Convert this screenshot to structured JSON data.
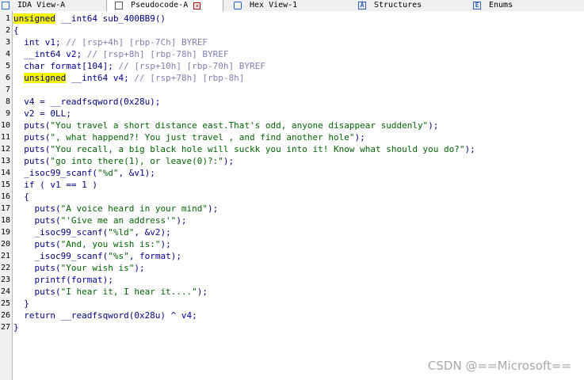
{
  "tabs": [
    {
      "label": "IDA View-A",
      "icon": "ida-view-icon",
      "closable": false,
      "active": false
    },
    {
      "label": "Pseudocode-A",
      "icon": "pseudocode-icon",
      "closable": true,
      "active": true
    },
    {
      "label": "Hex View-1",
      "icon": "hex-view-icon",
      "closable": false,
      "active": false
    },
    {
      "label": "Structures",
      "icon": "structures-icon",
      "closable": false,
      "active": false
    },
    {
      "label": "Enums",
      "icon": "enums-icon",
      "closable": false,
      "active": false
    }
  ],
  "close_glyph": "×",
  "code_lines": [
    {
      "n": "1",
      "tokens": [
        {
          "t": "unsigned",
          "c": "hl"
        },
        {
          "t": " __int64 sub_400BB9()",
          "c": "plain"
        }
      ]
    },
    {
      "n": "2",
      "tokens": [
        {
          "t": "{",
          "c": "plain"
        }
      ]
    },
    {
      "n": "3",
      "tokens": [
        {
          "t": "  int ",
          "c": "kw"
        },
        {
          "t": "v1",
          "c": "var"
        },
        {
          "t": "; ",
          "c": "plain"
        },
        {
          "t": "// [rsp+4h] [rbp-7Ch] BYREF",
          "c": "cmt"
        }
      ]
    },
    {
      "n": "4",
      "tokens": [
        {
          "t": "  __int64 ",
          "c": "kw"
        },
        {
          "t": "v2",
          "c": "var"
        },
        {
          "t": "; ",
          "c": "plain"
        },
        {
          "t": "// [rsp+8h] [rbp-78h] BYREF",
          "c": "cmt"
        }
      ]
    },
    {
      "n": "5",
      "tokens": [
        {
          "t": "  char ",
          "c": "kw"
        },
        {
          "t": "format",
          "c": "var"
        },
        {
          "t": "[104]; ",
          "c": "plain"
        },
        {
          "t": "// [rsp+10h] [rbp-70h] BYREF",
          "c": "cmt"
        }
      ]
    },
    {
      "n": "6",
      "tokens": [
        {
          "t": "  ",
          "c": "plain"
        },
        {
          "t": "unsigned",
          "c": "hl"
        },
        {
          "t": " __int64 ",
          "c": "kw"
        },
        {
          "t": "v4",
          "c": "var"
        },
        {
          "t": "; ",
          "c": "plain"
        },
        {
          "t": "// [rsp+78h] [rbp-8h]",
          "c": "cmt"
        }
      ]
    },
    {
      "n": "7",
      "tokens": []
    },
    {
      "n": "8",
      "tokens": [
        {
          "t": "  v4 = __readfsqword(0x28u);",
          "c": "plain"
        }
      ]
    },
    {
      "n": "9",
      "tokens": [
        {
          "t": "  v2 = 0LL;",
          "c": "plain"
        }
      ]
    },
    {
      "n": "10",
      "tokens": [
        {
          "t": "  puts(",
          "c": "plain"
        },
        {
          "t": "\"You travel a short distance east.That's odd, anyone disappear suddenly\"",
          "c": "str"
        },
        {
          "t": ");",
          "c": "plain"
        }
      ]
    },
    {
      "n": "11",
      "tokens": [
        {
          "t": "  puts(",
          "c": "plain"
        },
        {
          "t": "\", what happend?! You just travel , and find another hole\"",
          "c": "str"
        },
        {
          "t": ");",
          "c": "plain"
        }
      ]
    },
    {
      "n": "12",
      "tokens": [
        {
          "t": "  puts(",
          "c": "plain"
        },
        {
          "t": "\"You recall, a big black hole will suckk you into it! Know what should you do?\"",
          "c": "str"
        },
        {
          "t": ");",
          "c": "plain"
        }
      ]
    },
    {
      "n": "13",
      "tokens": [
        {
          "t": "  puts(",
          "c": "plain"
        },
        {
          "t": "\"go into there(1), or leave(0)?:\"",
          "c": "str"
        },
        {
          "t": ");",
          "c": "plain"
        }
      ]
    },
    {
      "n": "14",
      "tokens": [
        {
          "t": "  _isoc99_scanf(",
          "c": "plain"
        },
        {
          "t": "\"%d\"",
          "c": "str"
        },
        {
          "t": ", &",
          "c": "plain"
        },
        {
          "t": "v1",
          "c": "var"
        },
        {
          "t": ");",
          "c": "plain"
        }
      ]
    },
    {
      "n": "15",
      "tokens": [
        {
          "t": "  if ( ",
          "c": "plain"
        },
        {
          "t": "v1",
          "c": "var"
        },
        {
          "t": " == 1 )",
          "c": "plain"
        }
      ]
    },
    {
      "n": "16",
      "tokens": [
        {
          "t": "  {",
          "c": "plain"
        }
      ]
    },
    {
      "n": "17",
      "tokens": [
        {
          "t": "    puts(",
          "c": "plain"
        },
        {
          "t": "\"A voice heard in your mind\"",
          "c": "str"
        },
        {
          "t": ");",
          "c": "plain"
        }
      ]
    },
    {
      "n": "18",
      "tokens": [
        {
          "t": "    puts(",
          "c": "plain"
        },
        {
          "t": "\"'Give me an address'\"",
          "c": "str"
        },
        {
          "t": ");",
          "c": "plain"
        }
      ]
    },
    {
      "n": "19",
      "tokens": [
        {
          "t": "    _isoc99_scanf(",
          "c": "plain"
        },
        {
          "t": "\"%ld\"",
          "c": "str"
        },
        {
          "t": ", &",
          "c": "plain"
        },
        {
          "t": "v2",
          "c": "var"
        },
        {
          "t": ");",
          "c": "plain"
        }
      ]
    },
    {
      "n": "20",
      "tokens": [
        {
          "t": "    puts(",
          "c": "plain"
        },
        {
          "t": "\"And, you wish is:\"",
          "c": "str"
        },
        {
          "t": ");",
          "c": "plain"
        }
      ]
    },
    {
      "n": "21",
      "tokens": [
        {
          "t": "    _isoc99_scanf(",
          "c": "plain"
        },
        {
          "t": "\"%s\"",
          "c": "str"
        },
        {
          "t": ", ",
          "c": "plain"
        },
        {
          "t": "format",
          "c": "var"
        },
        {
          "t": ");",
          "c": "plain"
        }
      ]
    },
    {
      "n": "22",
      "tokens": [
        {
          "t": "    puts(",
          "c": "plain"
        },
        {
          "t": "\"Your wish is\"",
          "c": "str"
        },
        {
          "t": ");",
          "c": "plain"
        }
      ]
    },
    {
      "n": "23",
      "tokens": [
        {
          "t": "    printf(",
          "c": "plain"
        },
        {
          "t": "format",
          "c": "var"
        },
        {
          "t": ");",
          "c": "plain"
        }
      ]
    },
    {
      "n": "24",
      "tokens": [
        {
          "t": "    puts(",
          "c": "plain"
        },
        {
          "t": "\"I hear it, I hear it....\"",
          "c": "str"
        },
        {
          "t": ");",
          "c": "plain"
        }
      ]
    },
    {
      "n": "25",
      "tokens": [
        {
          "t": "  }",
          "c": "plain"
        }
      ]
    },
    {
      "n": "26",
      "tokens": [
        {
          "t": "  return __readfsqword(0x28u) ^ ",
          "c": "plain"
        },
        {
          "t": "v4",
          "c": "var"
        },
        {
          "t": ";",
          "c": "plain"
        }
      ]
    },
    {
      "n": "27",
      "tokens": [
        {
          "t": "}",
          "c": "plain"
        }
      ]
    }
  ],
  "watermark": "CSDN @==Microsoft==",
  "colors": {
    "highlight": "#f5f500",
    "keyword": "#000080",
    "string": "#006400",
    "comment": "#7f7fb0",
    "tab_close": "#c40000"
  }
}
